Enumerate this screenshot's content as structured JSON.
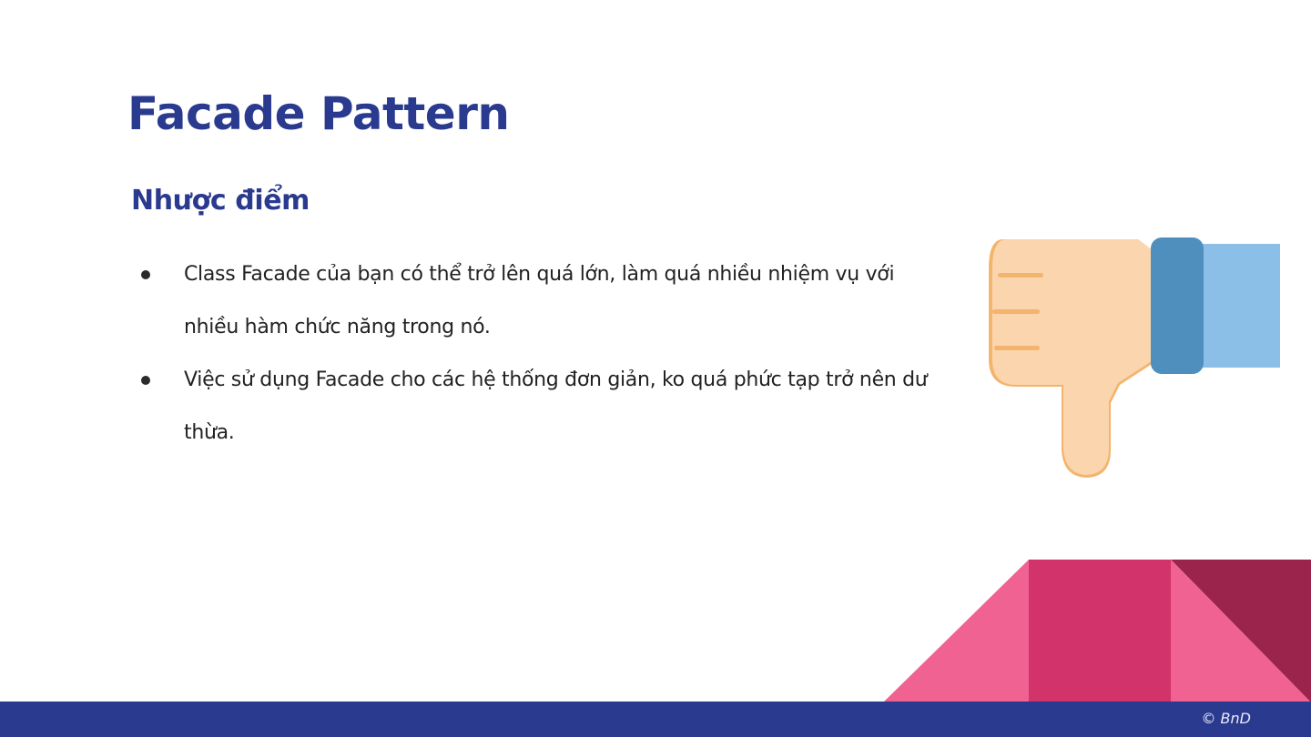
{
  "slide": {
    "title": "Facade Pattern",
    "subtitle": "Nhược điểm",
    "bullets": [
      "Class Facade của bạn có thể trở lên quá lớn, làm quá nhiều nhiệm vụ với nhiều hàm chức năng trong nó.",
      "Việc sử dụng Facade cho các hệ thống đơn giản, ko quá phức tạp trở nên dư thừa."
    ]
  },
  "footer": {
    "copyright": "© BnD"
  },
  "icons": {
    "illustration": "thumbs-down-icon",
    "bullet": "bullet-dot-icon"
  },
  "colors": {
    "title": "#2a3a8f",
    "text": "#222222",
    "footer_bar": "#2a3a8f",
    "pink_light": "#f06292",
    "pink_mid": "#d1336a",
    "maroon": "#9b244c",
    "skin": "#fad5ae",
    "skin_shadow": "#f3b46d",
    "cuff": "#4e8fbd",
    "sleeve": "#8bbfe8"
  }
}
